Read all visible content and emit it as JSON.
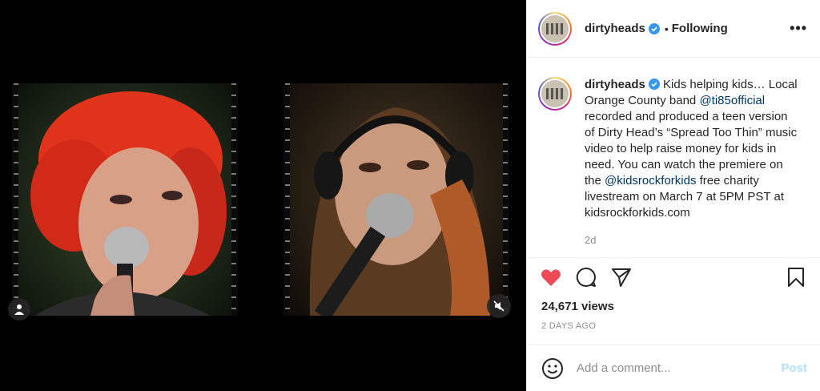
{
  "post": {
    "username": "dirtyheads",
    "follow_status": "Following",
    "more_label": "•••",
    "caption_parts": [
      "Kids helping kids… Local Orange County band ",
      "@ti85official",
      " recorded and produced a teen version of Dirty Head’s “Spread Too Thin” music video to help raise money for kids in need. You can watch the premiere on the ",
      "@kidsrockforkids",
      " free charity livestream on March 7 at 5PM PST at kidsrockforkids.com"
    ],
    "caption_age": "2d",
    "views": "24,671 views",
    "timestamp": "2 DAYS AGO"
  },
  "comment": {
    "placeholder": "Add a comment...",
    "post_label": "Post"
  },
  "icons": {
    "like": "heart-icon",
    "comment": "comment-icon",
    "share": "share-icon",
    "save": "bookmark-icon",
    "mute": "muted-speaker-icon",
    "tag": "user-tag-icon",
    "emoji": "emoji-icon",
    "verified": "verified-badge-icon"
  },
  "colors": {
    "like_red": "#ed4956",
    "verified_blue": "#3897f0",
    "mention_blue": "#00376b",
    "post_disabled": "#b2dffc"
  }
}
